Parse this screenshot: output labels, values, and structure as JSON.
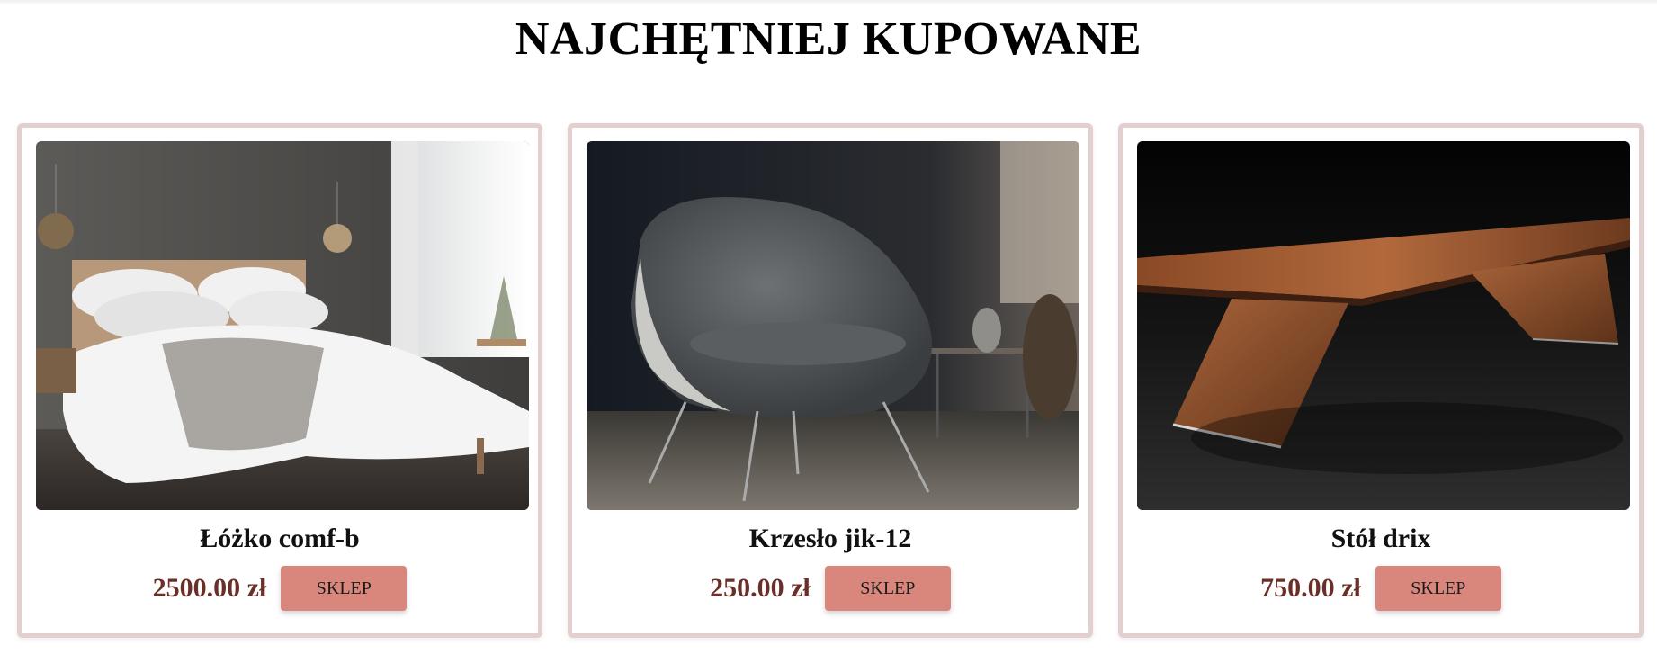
{
  "page": {
    "title": "NAJCHĘTNIEJ KUPOWANE"
  },
  "colors": {
    "card_border": "#e4cfcf",
    "button_bg": "#d9877c",
    "price_text": "#6b2f2a"
  },
  "products": [
    {
      "name": "Łóżko comf-b",
      "price": "2500.00 zł",
      "button_label": "SKLEP",
      "image": "bed-photo"
    },
    {
      "name": "Krzesło jik-12",
      "price": "250.00 zł",
      "button_label": "SKLEP",
      "image": "chair-photo"
    },
    {
      "name": "Stół drix",
      "price": "750.00 zł",
      "button_label": "SKLEP",
      "image": "table-photo"
    }
  ]
}
